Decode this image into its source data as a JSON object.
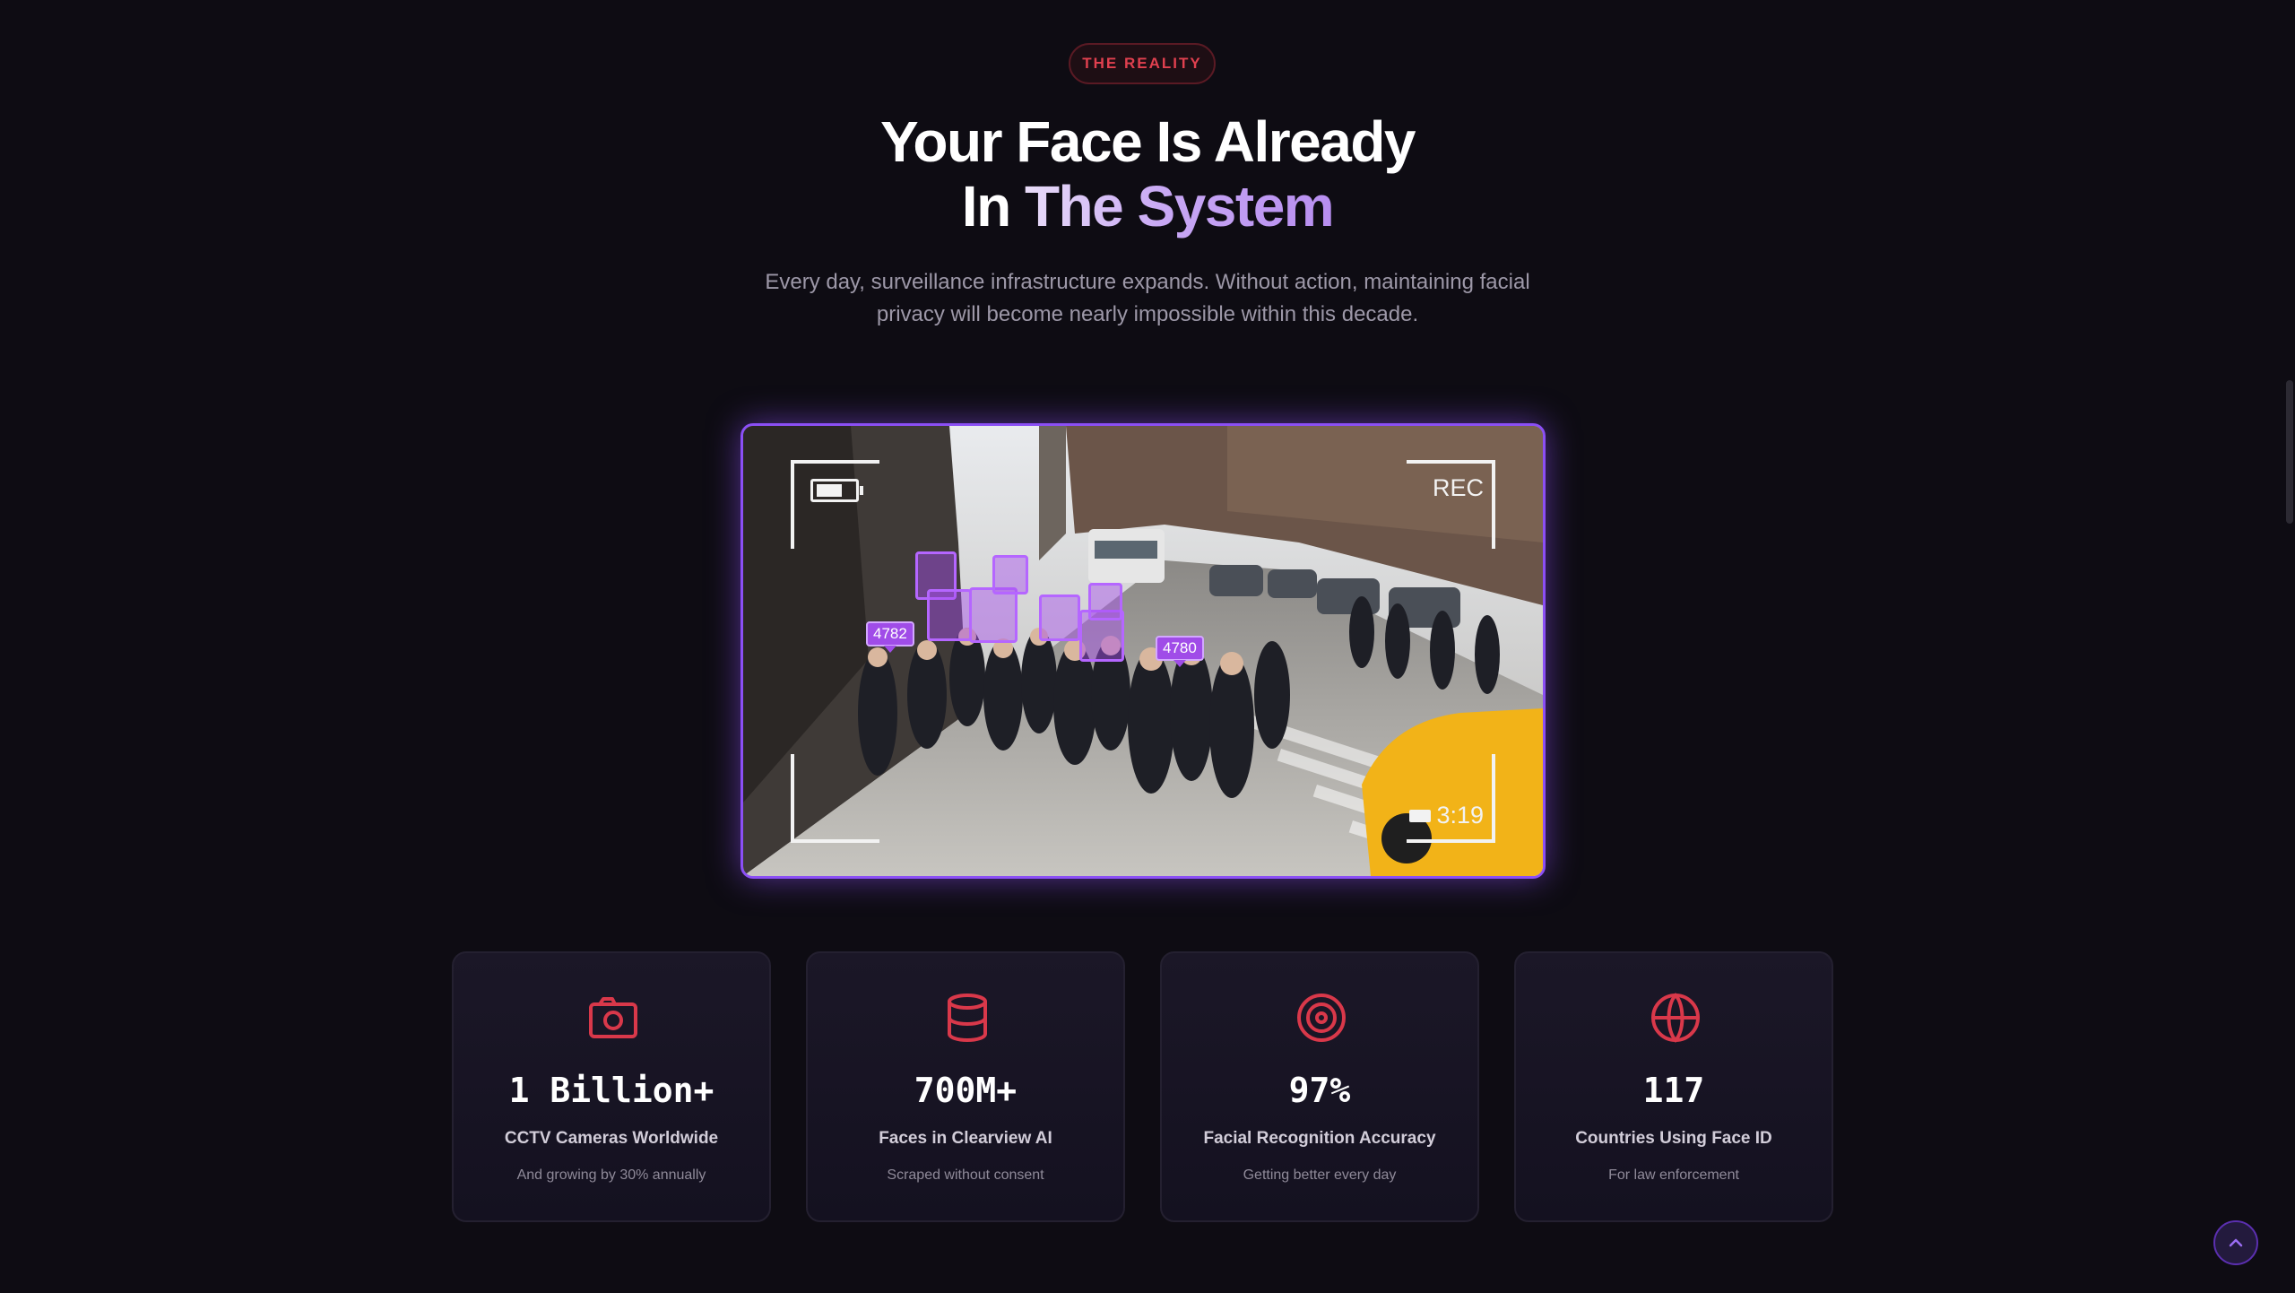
{
  "section": {
    "eyebrow": "THE REALITY",
    "headline_line1": "Your Face Is Already",
    "headline_line2_prefix": "In ",
    "headline_line2_highlight": "The System",
    "subtitle": "Every day, surveillance infrastructure expands. Without action, maintaining facial privacy will become nearly impossible within this decade."
  },
  "video": {
    "rec_label": "REC",
    "timecode": "3:19",
    "face_ids": [
      "4782",
      "4780"
    ]
  },
  "stats": [
    {
      "icon": "camera-icon",
      "value": "1 Billion+",
      "label": "CCTV Cameras Worldwide",
      "note": "And growing by 30% annually"
    },
    {
      "icon": "database-icon",
      "value": "700M+",
      "label": "Faces in Clearview AI",
      "note": "Scraped without consent"
    },
    {
      "icon": "target-icon",
      "value": "97%",
      "label": "Facial Recognition Accuracy",
      "note": "Getting better every day"
    },
    {
      "icon": "globe-icon",
      "value": "117",
      "label": "Countries Using Face ID",
      "note": "For law enforcement"
    }
  ],
  "colors": {
    "background": "#0e0c13",
    "accent_red": "#e0404f",
    "accent_purple": "#8b4ff5",
    "icon_red": "#d9384a"
  },
  "controls": {
    "back_to_top_icon": "chevron-up-icon"
  }
}
